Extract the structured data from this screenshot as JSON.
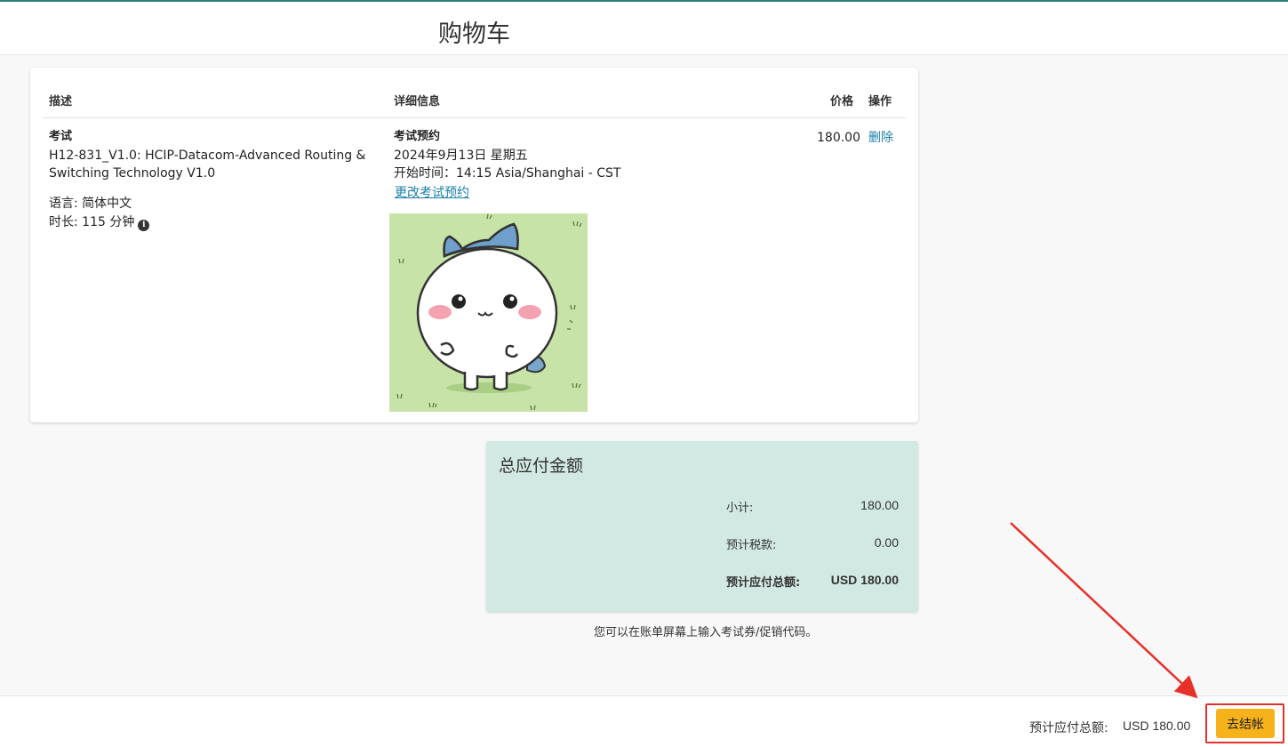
{
  "header": {
    "title": "购物车"
  },
  "table": {
    "headers": {
      "description": "描述",
      "details": "详细信息",
      "price": "价格",
      "action": "操作"
    },
    "row": {
      "type_label": "考试",
      "exam_name_line1": "H12-831_V1.0: HCIP-Datacom-Advanced Routing &",
      "exam_name_line2": "Switching Technology V1.0",
      "language": "语言: 简体中文",
      "duration": "时长: 115 分钟",
      "info_icon": "info-icon",
      "appointment_label": "考试预约",
      "date": "2024年9月13日 星期五",
      "start_time": "开始时间：14:15 Asia/Shanghai - CST",
      "change_link": "更改考试预约",
      "price": "180.00",
      "delete_link": "删除"
    }
  },
  "summary": {
    "title": "总应付金额",
    "subtotal_label": "小计:",
    "subtotal_value": "180.00",
    "tax_label": "预计税款:",
    "tax_value": "0.00",
    "total_label": "预计应付总额:",
    "total_value": "USD 180.00"
  },
  "promo_note": "您可以在账单屏幕上输入考试券/促销代码。",
  "footer": {
    "total_label": "预计应付总额:",
    "total_value": "USD 180.00",
    "checkout_label": "去结帐"
  },
  "colors": {
    "accent": "#2a7f7a",
    "link": "#1a7fa8",
    "summary_bg": "#d2e9e3",
    "checkout_button": "#f6b21b",
    "annotation_red": "#e8302a"
  }
}
